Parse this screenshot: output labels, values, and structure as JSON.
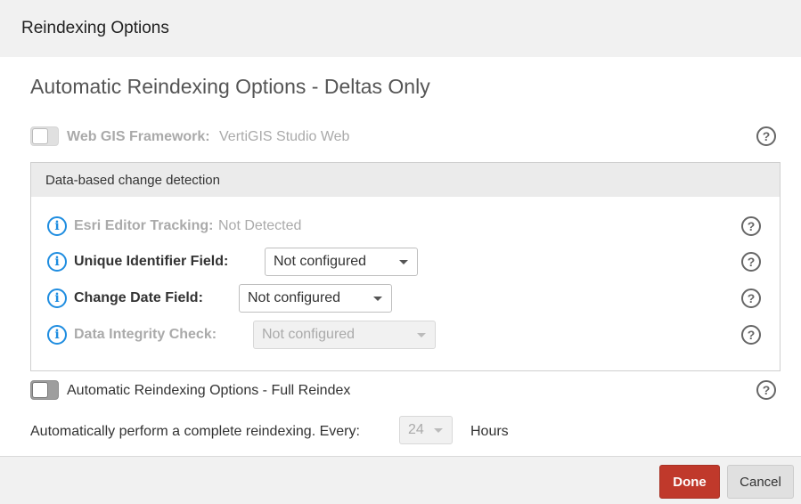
{
  "dialog": {
    "title": "Reindexing Options"
  },
  "deltas": {
    "title": "Automatic Reindexing Options - Deltas Only",
    "web_gis": {
      "label": "Web GIS Framework:",
      "value": "VertiGIS Studio Web",
      "enabled": false
    }
  },
  "panel": {
    "title": "Data-based change detection",
    "rows": [
      {
        "label": "Esri Editor Tracking:",
        "value": "Not Detected",
        "disabled": true
      },
      {
        "label": "Unique Identifier Field:",
        "selected": "Not configured",
        "disabled": false
      },
      {
        "label": "Change Date Field:",
        "selected": "Not configured",
        "disabled": false
      },
      {
        "label": "Data Integrity Check:",
        "selected": "Not configured",
        "disabled": true
      }
    ]
  },
  "full": {
    "title": "Automatic Reindexing Options - Full Reindex",
    "enabled": false,
    "every_label": "Automatically perform a complete reindexing. Every:",
    "every_value": "24",
    "unit": "Hours"
  },
  "icons": {
    "help": "?",
    "info": "i"
  },
  "footer": {
    "done": "Done",
    "cancel": "Cancel"
  },
  "colors": {
    "primary": "#c0392b",
    "info": "#1f8de0"
  }
}
